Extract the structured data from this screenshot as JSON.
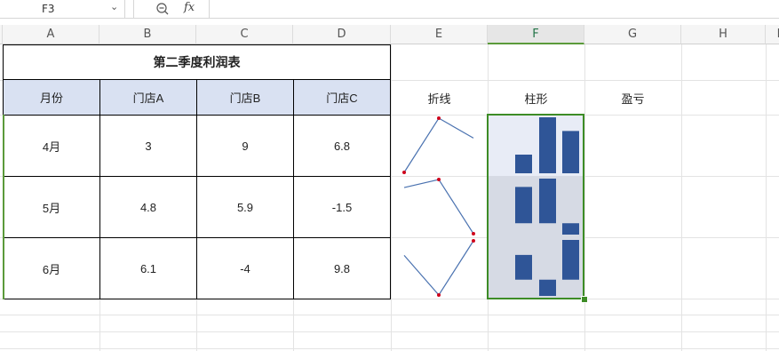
{
  "formula_bar": {
    "cell_ref": "F3",
    "zoom_icon": "zoom-icon",
    "fx_label": "fx"
  },
  "columns": [
    "A",
    "B",
    "C",
    "D",
    "E",
    "F",
    "G",
    "H",
    "I"
  ],
  "table": {
    "title": "第二季度利润表",
    "headers": [
      "月份",
      "门店A",
      "门店B",
      "门店C"
    ],
    "rows": [
      {
        "month": "4月",
        "a": "3",
        "b": "9",
        "c": "6.8"
      },
      {
        "month": "5月",
        "a": "4.8",
        "b": "5.9",
        "c": "-1.5"
      },
      {
        "month": "6月",
        "a": "6.1",
        "b": "-4",
        "c": "9.8"
      }
    ]
  },
  "labels": {
    "line": "折线",
    "column": "柱形",
    "winloss": "盈亏"
  },
  "sparkline_data": [
    [
      3,
      9,
      6.8
    ],
    [
      4.8,
      5.9,
      -1.5
    ],
    [
      6.1,
      -4,
      9.8
    ]
  ],
  "colors": {
    "line": "#4a72b0",
    "marker": "#d0021b",
    "bar": "#2f5597",
    "header_fill": "#d9e1f2",
    "selection": "#3d8c26",
    "row1_bg": "#e8ecf6",
    "row_bg": "#d6dae4"
  }
}
